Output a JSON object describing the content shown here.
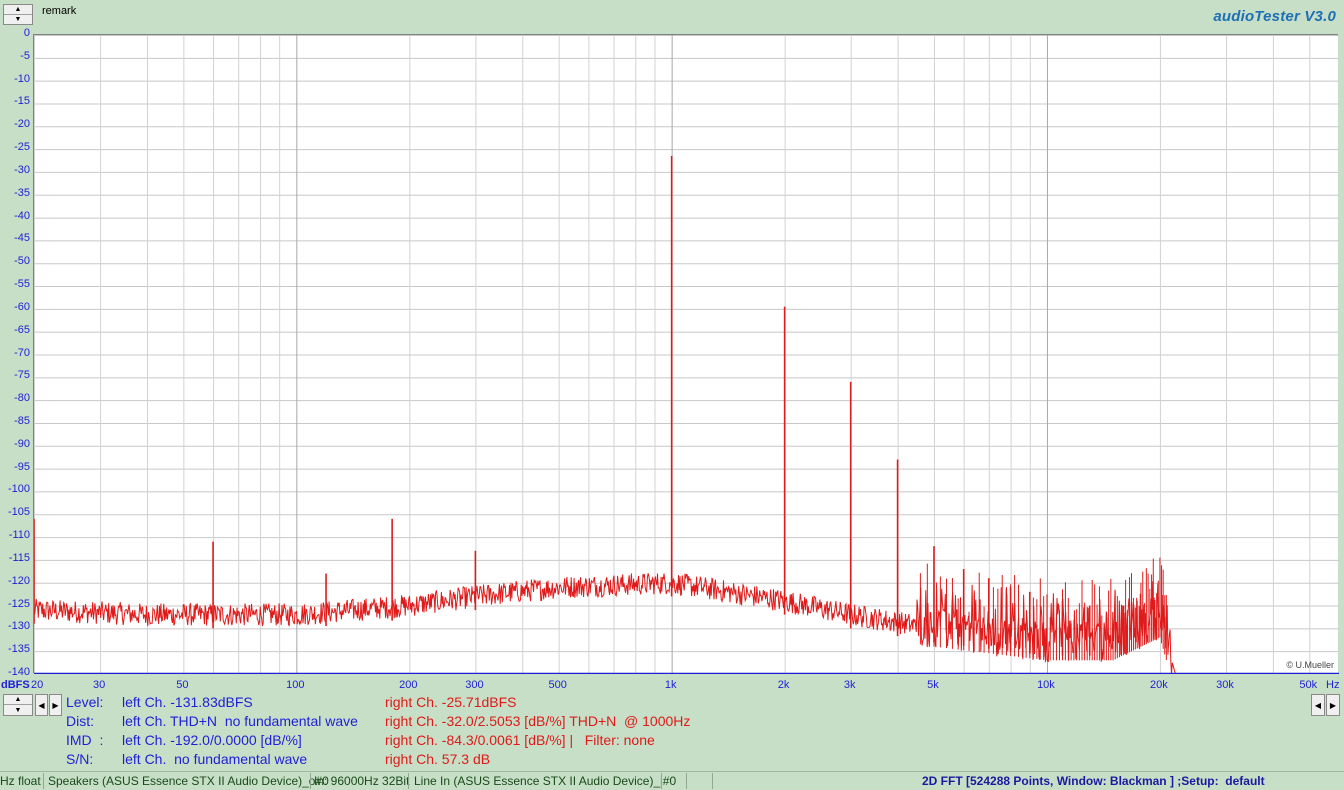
{
  "header": {
    "remark_label": "remark",
    "brand": "audioTester  V3.0"
  },
  "copyright": "© U.Mueller",
  "chart_data": {
    "type": "line",
    "title": "",
    "xlabel": "Hz",
    "ylabel": "dBFS",
    "x_scale": "log",
    "xlim": [
      20,
      60000
    ],
    "ylim": [
      -140,
      0
    ],
    "grid": true,
    "x_ticks": [
      {
        "v": 20,
        "label": "20"
      },
      {
        "v": 30,
        "label": "30"
      },
      {
        "v": 50,
        "label": "50"
      },
      {
        "v": 100,
        "label": "100"
      },
      {
        "v": 200,
        "label": "200"
      },
      {
        "v": 300,
        "label": "300"
      },
      {
        "v": 500,
        "label": "500"
      },
      {
        "v": 1000,
        "label": "1k"
      },
      {
        "v": 2000,
        "label": "2k"
      },
      {
        "v": 3000,
        "label": "3k"
      },
      {
        "v": 5000,
        "label": "5k"
      },
      {
        "v": 10000,
        "label": "10k"
      },
      {
        "v": 20000,
        "label": "20k"
      },
      {
        "v": 30000,
        "label": "30k"
      },
      {
        "v": 50000,
        "label": "50k"
      }
    ],
    "y_ticks": [
      0,
      -5,
      -10,
      -15,
      -20,
      -25,
      -30,
      -35,
      -40,
      -45,
      -50,
      -55,
      -60,
      -65,
      -70,
      -75,
      -80,
      -85,
      -90,
      -95,
      -100,
      -105,
      -110,
      -115,
      -120,
      -125,
      -130,
      -135,
      -140
    ],
    "series": [
      {
        "color": "#e01a1a",
        "noise_floor": [
          [
            20,
            -126
          ],
          [
            40,
            -127
          ],
          [
            100,
            -127
          ],
          [
            200,
            -125
          ],
          [
            300,
            -123
          ],
          [
            500,
            -121
          ],
          [
            1000,
            -120
          ],
          [
            2000,
            -124
          ],
          [
            3000,
            -127
          ],
          [
            5000,
            -130
          ],
          [
            10000,
            -133
          ],
          [
            15000,
            -133
          ],
          [
            20000,
            -128
          ],
          [
            22000,
            -140
          ],
          [
            60000,
            -140
          ]
        ],
        "peaks": [
          {
            "f": 20,
            "db": -106
          },
          {
            "f": 60,
            "db": -111
          },
          {
            "f": 120,
            "db": -118
          },
          {
            "f": 180,
            "db": -106
          },
          {
            "f": 300,
            "db": -113
          },
          {
            "f": 1000,
            "db": -26.5
          },
          {
            "f": 2000,
            "db": -59.5
          },
          {
            "f": 3000,
            "db": -76
          },
          {
            "f": 4000,
            "db": -93
          },
          {
            "f": 5000,
            "db": -112
          },
          {
            "f": 6000,
            "db": -117
          },
          {
            "f": 7000,
            "db": -119
          },
          {
            "f": 8000,
            "db": -121
          },
          {
            "f": 9000,
            "db": -122
          },
          {
            "f": 11000,
            "db": -124
          },
          {
            "f": 13000,
            "db": -125
          },
          {
            "f": 16000,
            "db": -125
          }
        ]
      },
      {
        "color": "#1f1fd6",
        "constant_db": -140
      }
    ]
  },
  "info": {
    "rows": [
      {
        "label": "Level:",
        "left": "left Ch. -131.83dBFS",
        "right": "right Ch. -25.71dBFS"
      },
      {
        "label": "Dist:",
        "left": "left Ch. THD+N  no fundamental wave",
        "right": "right Ch. -32.0/2.5053 [dB/%] THD+N  @ 1000Hz"
      },
      {
        "label": "IMD  :",
        "left": "left Ch. -192.0/0.0000 [dB/%]",
        "right": "right Ch. -84.3/0.0061 [dB/%] |   Filter: none"
      },
      {
        "label": "S/N:",
        "left": "left Ch.  no fundamental wave",
        "right": "right Ch. 57.3 dB"
      }
    ]
  },
  "status": {
    "seg1": "Hz float",
    "seg2": "Speakers (ASUS Essence STX II Audio Device)_o#0",
    "seg3": "In: 96000Hz 32Bit",
    "seg4": "Line In (ASUS Essence STX II Audio Device)_i#0",
    "seg5": "2D FFT [524288 Points, Window: Blackman ] ;Setup:  default"
  }
}
